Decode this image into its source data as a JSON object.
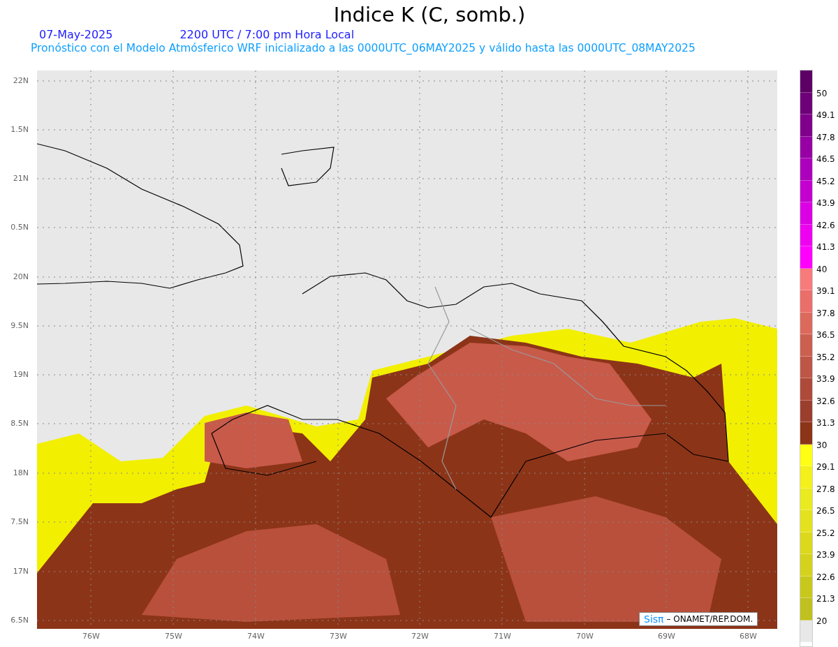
{
  "title": "Indice K (C, somb.)",
  "date": "07-May-2025",
  "time_info": "2200 UTC / 7:00 pm Hora Local",
  "subtitle": "Pronóstico con el Modelo Atmósferico WRF inicializado a las 0000UTC_06MAY2025 y válido hasta las  0000UTC_08MAY2025",
  "map": {
    "y_axis_labels": [
      "22N",
      "1.5N",
      "21N",
      "0.5N",
      "20N",
      "9.5N",
      "19N",
      "8.5N",
      "18N",
      "7.5N",
      "17N",
      "6.5N"
    ],
    "x_axis_labels": [
      "76W",
      "75W",
      "74W",
      "73W",
      "72W",
      "71W",
      "70W",
      "69W",
      "68W"
    ],
    "credit": {
      "logo": "Sisπ",
      "text": "– ONAMET/REP.DOM."
    }
  },
  "legend": [
    {
      "color": "#5c0066",
      "label": "50"
    },
    {
      "color": "#6e0078",
      "label": "49.1"
    },
    {
      "color": "#80008c",
      "label": "47.8"
    },
    {
      "color": "#9600a4",
      "label": "46.5"
    },
    {
      "color": "#ac00bc",
      "label": "45.2"
    },
    {
      "color": "#c400d0",
      "label": "43.9"
    },
    {
      "color": "#dc00e4",
      "label": "42.6"
    },
    {
      "color": "#ee00f0",
      "label": "41.3"
    },
    {
      "color": "#ff00ff",
      "label": "40"
    },
    {
      "color": "#f77b7b",
      "label": "39.1"
    },
    {
      "color": "#ea6e6a",
      "label": "37.8"
    },
    {
      "color": "#dc6a5c",
      "label": "36.5"
    },
    {
      "color": "#cc6050",
      "label": "35.2"
    },
    {
      "color": "#bd5646",
      "label": "33.9"
    },
    {
      "color": "#ad4a3a",
      "label": "32.6"
    },
    {
      "color": "#9c3e2e",
      "label": "31.3"
    },
    {
      "color": "#8c3418",
      "label": "30"
    },
    {
      "color": "#ffff14",
      "label": "29.1"
    },
    {
      "color": "#f4f01c",
      "label": "27.8"
    },
    {
      "color": "#eaea20",
      "label": "26.5"
    },
    {
      "color": "#e4e21e",
      "label": "25.2"
    },
    {
      "color": "#dcd81c",
      "label": "23.9"
    },
    {
      "color": "#d4d21c",
      "label": "22.6"
    },
    {
      "color": "#c8c81c",
      "label": "21.3"
    },
    {
      "color": "#c0c020",
      "label": "20"
    },
    {
      "color": "#e8e8e8"
    }
  ]
}
